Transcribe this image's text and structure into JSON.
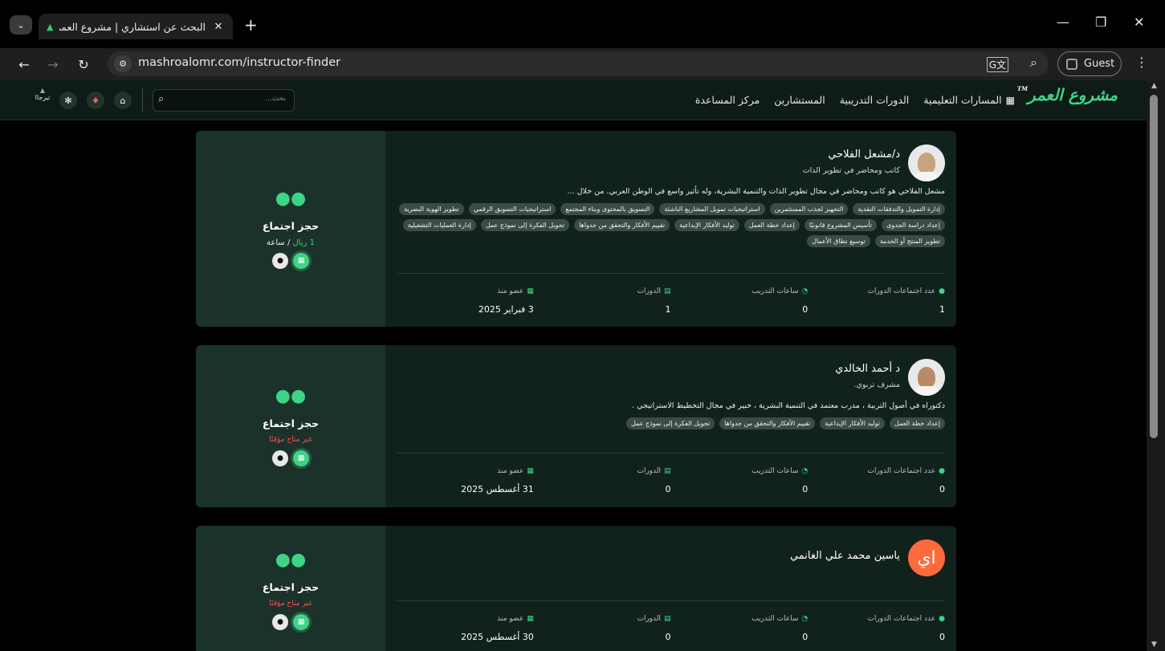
{
  "browser": {
    "tab_title": "البحث عن استشاري | مشروع العمر",
    "tab_close": "✕",
    "new_tab": "+",
    "url": "mashroalomr.com/instructor-finder",
    "profile_label": "Guest",
    "window_minimize": "—",
    "window_restore": "❐",
    "window_close": "✕"
  },
  "header": {
    "logo_text": "مشروع العمر",
    "logo_tm": "TM",
    "nav": [
      {
        "label": "المسارات التعليمية",
        "icon": "grid-icon"
      },
      {
        "label": "الدورات التدريبية"
      },
      {
        "label": "المستشارين"
      },
      {
        "label": "مركز المساعدة"
      }
    ],
    "search_placeholder": "بحث...",
    "user_label": "تيرجاا"
  },
  "cards": [
    {
      "name": "د/مشعل الفلاحي",
      "role": "كاتب ومحاضر في تطوير الذات",
      "bio": "مشعل الفلاحي هو كاتب ومحاضر في مجال تطوير الذات والتنمية البشرية، وله تأثير واسع في الوطن العربي. من خلال ...",
      "avatar": "photo",
      "tags": [
        "إدارة التمويل والتدفقات النقدية",
        "التجهيز لجذب المستثمرين",
        "استراتيجيات تمويل المشاريع الناشئة",
        "التسويق بالمحتوى وبناء المجتمع",
        "استراتيجيات التسويق الرقمي",
        "تطوير الهوية البصرية",
        "إعداد دراسة الجدوى",
        "تأسيس المشروع قانونيًا",
        "إعداد خطة العمل",
        "توليد الأفكار الإبداعية",
        "تقييم الأفكار والتحقق من جدواها",
        "تحويل الفكرة إلى نموذج عمل",
        "إدارة العمليات التشغيلية",
        "تطوير المنتج أو الخدمة",
        "توسيع نطاق الأعمال"
      ],
      "booking": {
        "title": "حجز اجتماع",
        "price": "1 ريال",
        "unit": "/ ساعة",
        "unavailable": ""
      },
      "stats": [
        {
          "label": "عدد اجتماعات الدورات",
          "value": "1",
          "icon": "chat-icon"
        },
        {
          "label": "ساعات التدريب",
          "value": "0",
          "icon": "clock-icon"
        },
        {
          "label": "الدورات",
          "value": "1",
          "icon": "book-icon"
        },
        {
          "label": "عضو منذ",
          "value": "3 فبراير 2025",
          "icon": "calendar-icon"
        }
      ]
    },
    {
      "name": "د أحمد الخالدي",
      "role": "مشرف تربوي.",
      "bio": "دكتوراه في أصول التربية ، مدرب معتمد في التنمية البشرية ، خبير في مجال التخطيط الاستراتيجي .",
      "avatar": "photo",
      "tags": [
        "إعداد خطة العمل",
        "توليد الأفكار الإبداعية",
        "تقييم الأفكار والتحقق من جدواها",
        "تحويل الفكرة إلى نموذج عمل"
      ],
      "booking": {
        "title": "حجز اجتماع",
        "price": "",
        "unit": "",
        "unavailable": "غير متاح مؤقتًا"
      },
      "stats": [
        {
          "label": "عدد اجتماعات الدورات",
          "value": "0",
          "icon": "chat-icon"
        },
        {
          "label": "ساعات التدريب",
          "value": "0",
          "icon": "clock-icon"
        },
        {
          "label": "الدورات",
          "value": "0",
          "icon": "book-icon"
        },
        {
          "label": "عضو منذ",
          "value": "31 أغسطس 2025",
          "icon": "calendar-icon"
        }
      ]
    },
    {
      "name": "ياسين محمد علي الغانمي",
      "role": "",
      "bio": "",
      "avatar_letter": "اي",
      "tags": [],
      "booking": {
        "title": "حجز اجتماع",
        "price": "",
        "unit": "",
        "unavailable": "غير متاح مؤقتًا"
      },
      "stats": [
        {
          "label": "عدد اجتماعات الدورات",
          "value": "0",
          "icon": "chat-icon"
        },
        {
          "label": "ساعات التدريب",
          "value": "0",
          "icon": "clock-icon"
        },
        {
          "label": "الدورات",
          "value": "0",
          "icon": "book-icon"
        },
        {
          "label": "عضو منذ",
          "value": "30 أغسطس 2025",
          "icon": "calendar-icon"
        }
      ]
    }
  ],
  "colors": {
    "accent": "#3ed488",
    "card_bg": "#11221c",
    "panel_bg": "#1b322a",
    "header_bg": "#0e1b17",
    "unavailable": "#ff4d4d"
  }
}
